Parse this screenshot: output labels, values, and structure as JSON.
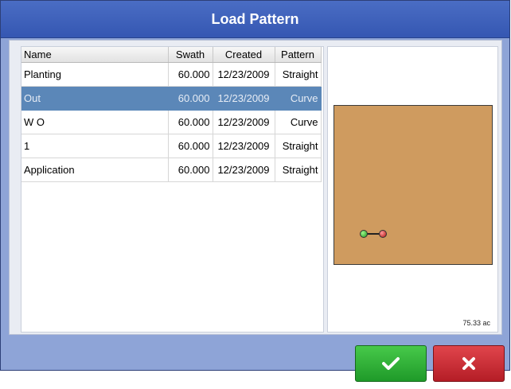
{
  "dialog": {
    "title": "Load Pattern"
  },
  "table": {
    "columns": [
      "Name",
      "Swath",
      "Created",
      "Pattern"
    ],
    "selected_row": 1,
    "rows": [
      {
        "name": "Planting",
        "swath": "60.000",
        "created": "12/23/2009",
        "pattern": "Straight"
      },
      {
        "name": "Out",
        "swath": "60.000",
        "created": "12/23/2009",
        "pattern": "Curve"
      },
      {
        "name": "W O",
        "swath": "60.000",
        "created": "12/23/2009",
        "pattern": "Curve"
      },
      {
        "name": "1",
        "swath": "60.000",
        "created": "12/23/2009",
        "pattern": "Straight"
      },
      {
        "name": "Application",
        "swath": "60.000",
        "created": "12/23/2009",
        "pattern": "Straight"
      }
    ]
  },
  "preview": {
    "area_label": "75.33 ac",
    "field_color": "#cf9b5f",
    "start_marker_color": "#2fbf2f",
    "end_marker_color": "#d81f1f"
  },
  "buttons": {
    "ok_icon": "checkmark-icon",
    "cancel_icon": "x-icon",
    "ok_color": "#2fb135",
    "cancel_color": "#c9282f"
  },
  "colors": {
    "window_bg": "#8ea4d7",
    "titlebar": "#3d5fb9",
    "selection": "#5b87b8"
  }
}
